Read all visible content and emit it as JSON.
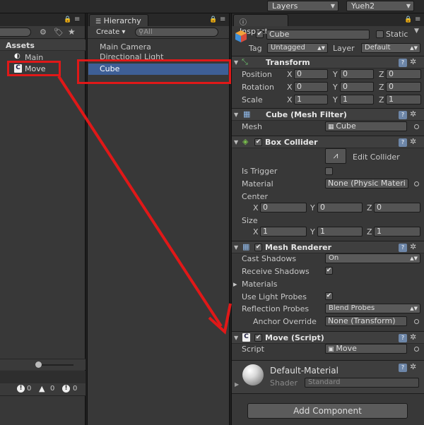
{
  "topbar": {
    "layers_label": "Layers",
    "layout_label": "Yueh2"
  },
  "project": {
    "assets_heading": "Assets",
    "items": [
      {
        "label": "Main"
      },
      {
        "label": "Move"
      }
    ],
    "console_counts": [
      "0",
      "0",
      "0"
    ]
  },
  "hierarchy": {
    "tab_label": "Hierarchy",
    "create_label": "Create",
    "search_placeholder": "All",
    "items": [
      {
        "label": "Main Camera"
      },
      {
        "label": "Directional Light"
      },
      {
        "label": "Cube"
      }
    ]
  },
  "inspector": {
    "tab_label": "Inspector",
    "object_name": "Cube",
    "static_label": "Static",
    "tag_label": "Tag",
    "tag_value": "Untagged",
    "layer_label": "Layer",
    "layer_value": "Default",
    "transform": {
      "title": "Transform",
      "position_label": "Position",
      "rotation_label": "Rotation",
      "scale_label": "Scale",
      "x_axis": "X",
      "y_axis": "Y",
      "z_axis": "Z",
      "position": [
        "0",
        "0",
        "0"
      ],
      "rotation": [
        "0",
        "0",
        "0"
      ],
      "scale": [
        "1",
        "1",
        "1"
      ]
    },
    "mesh_filter": {
      "title": "Cube (Mesh Filter)",
      "mesh_label": "Mesh",
      "mesh_value": "Cube"
    },
    "box_collider": {
      "title": "Box Collider",
      "edit_collider_label": "Edit Collider",
      "is_trigger_label": "Is Trigger",
      "material_label": "Material",
      "material_value": "None (Physic Materi",
      "center_label": "Center",
      "center": [
        "0",
        "0",
        "0"
      ],
      "size_label": "Size",
      "size": [
        "1",
        "1",
        "1"
      ]
    },
    "mesh_renderer": {
      "title": "Mesh Renderer",
      "cast_shadows_label": "Cast Shadows",
      "cast_shadows_value": "On",
      "receive_shadows_label": "Receive Shadows",
      "materials_label": "Materials",
      "use_light_probes_label": "Use Light Probes",
      "reflection_probes_label": "Reflection Probes",
      "reflection_probes_value": "Blend Probes",
      "anchor_override_label": "Anchor Override",
      "anchor_override_value": "None (Transform)"
    },
    "move_script": {
      "title": "Move (Script)",
      "script_label": "Script",
      "script_value": "Move"
    },
    "material": {
      "name": "Default-Material",
      "shader_label": "Shader",
      "shader_value": "Standard"
    },
    "add_component_label": "Add Component"
  },
  "colors": {
    "selection": "#3e5f96",
    "annotation_red": "#e01818",
    "panel_bg": "#383838",
    "icon_blue": "#6d86a8"
  }
}
